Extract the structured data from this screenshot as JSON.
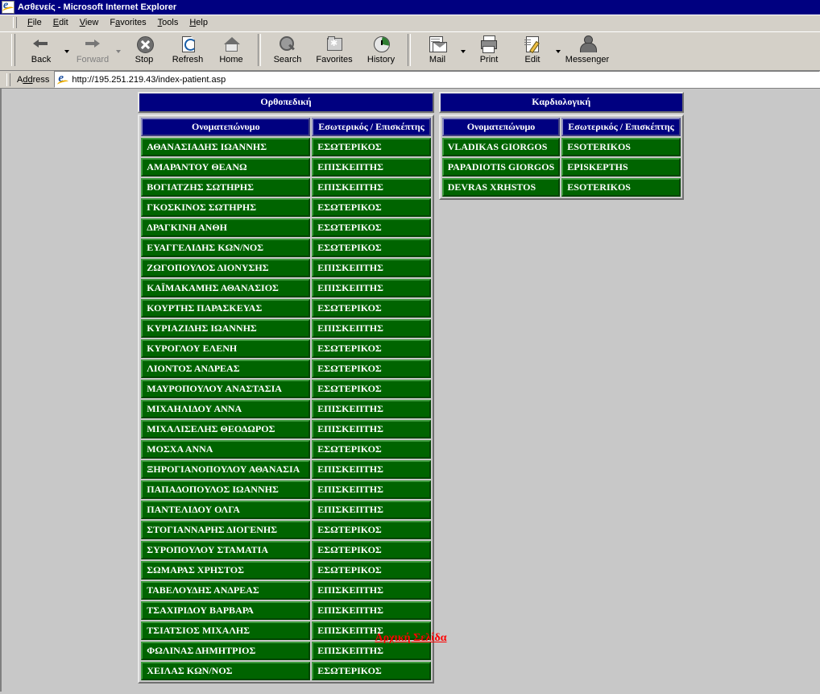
{
  "window": {
    "title": "Ασθενείς - Microsoft Internet Explorer",
    "icon": "ie-logo-icon"
  },
  "menubar": {
    "items": [
      {
        "label": "File",
        "accel": "F"
      },
      {
        "label": "Edit",
        "accel": "E"
      },
      {
        "label": "View",
        "accel": "V"
      },
      {
        "label": "Favorites",
        "accel": "a"
      },
      {
        "label": "Tools",
        "accel": "T"
      },
      {
        "label": "Help",
        "accel": "H"
      }
    ]
  },
  "toolbar": {
    "buttons": [
      {
        "label": "Back",
        "icon": "back-arrow-icon",
        "disabled": false,
        "dropdown": true
      },
      {
        "label": "Forward",
        "icon": "forward-arrow-icon",
        "disabled": true,
        "dropdown": true
      },
      {
        "label": "Stop",
        "icon": "stop-icon",
        "disabled": false,
        "dropdown": false
      },
      {
        "label": "Refresh",
        "icon": "refresh-icon",
        "disabled": false,
        "dropdown": false
      },
      {
        "label": "Home",
        "icon": "home-icon",
        "disabled": false,
        "dropdown": false
      },
      {
        "label": "Search",
        "icon": "search-icon",
        "disabled": false,
        "dropdown": false
      },
      {
        "label": "Favorites",
        "icon": "favorites-folder-icon",
        "disabled": false,
        "dropdown": false
      },
      {
        "label": "History",
        "icon": "history-clock-icon",
        "disabled": false,
        "dropdown": false
      },
      {
        "label": "Mail",
        "icon": "mail-icon",
        "disabled": false,
        "dropdown": true
      },
      {
        "label": "Print",
        "icon": "printer-icon",
        "disabled": false,
        "dropdown": false
      },
      {
        "label": "Edit",
        "icon": "edit-pencil-icon",
        "disabled": false,
        "dropdown": true
      },
      {
        "label": "Messenger",
        "icon": "messenger-person-icon",
        "disabled": false,
        "dropdown": false
      }
    ]
  },
  "address_bar": {
    "label": "Address",
    "icon": "ie-page-icon",
    "url": "http://195.251.219.43/index-patient.asp"
  },
  "page": {
    "columns": [
      "Ονοματεπώνυμο",
      "Εσωτερικός / Επισκέπτης"
    ],
    "departments": [
      {
        "name": "Ορθοπεδική",
        "rows": [
          {
            "name": "ΑΘΑΝΑΣΙΑΔΗΣ ΙΩΑΝΝΗΣ",
            "status": "ΕΣΩΤΕΡΙΚΟΣ"
          },
          {
            "name": "ΑΜΑΡΑΝΤΟΥ ΘΕΑΝΩ",
            "status": "ΕΠΙΣΚΕΠΤΗΣ"
          },
          {
            "name": "ΒΟΓΙΑΤΖΗΣ ΣΩΤΗΡΗΣ",
            "status": "ΕΠΙΣΚΕΠΤΗΣ"
          },
          {
            "name": "ΓΚΟΣΚΙΝΟΣ ΣΩΤΗΡΗΣ",
            "status": "ΕΣΩΤΕΡΙΚΟΣ"
          },
          {
            "name": "ΔΡΑΓΚΙΝΗ ΑΝΘΗ",
            "status": "ΕΣΩΤΕΡΙΚΟΣ"
          },
          {
            "name": "ΕΥΑΓΓΕΛΙΔΗΣ ΚΩΝ/ΝΟΣ",
            "status": "ΕΣΩΤΕΡΙΚΟΣ"
          },
          {
            "name": "ΖΩΓΟΠΟΥΛΟΣ ΔΙΟΝΥΣΗΣ",
            "status": "ΕΠΙΣΚΕΠΤΗΣ"
          },
          {
            "name": "ΚΑΪΜΑΚΑΜΗΣ ΑΘΑΝΑΣΙΟΣ",
            "status": "ΕΠΙΣΚΕΠΤΗΣ"
          },
          {
            "name": "ΚΟΥΡΤΗΣ ΠΑΡΑΣΚΕΥΑΣ",
            "status": "ΕΣΩΤΕΡΙΚΟΣ"
          },
          {
            "name": "ΚΥΡΙΑΖΙΔΗΣ ΙΩΑΝΝΗΣ",
            "status": "ΕΠΙΣΚΕΠΤΗΣ"
          },
          {
            "name": "ΚΥΡΟΓΛΟΥ ΕΛΕΝΗ",
            "status": "ΕΣΩΤΕΡΙΚΟΣ"
          },
          {
            "name": "ΛΙΟΝΤΟΣ ΑΝΔΡΕΑΣ",
            "status": "ΕΣΩΤΕΡΙΚΟΣ"
          },
          {
            "name": "ΜΑΥΡΟΠΟΥΛΟΥ ΑΝΑΣΤΑΣΙΑ",
            "status": "ΕΣΩΤΕΡΙΚΟΣ"
          },
          {
            "name": "ΜΙΧΑΗΛΙΔΟΥ ΑΝΝΑ",
            "status": "ΕΠΙΣΚΕΠΤΗΣ"
          },
          {
            "name": "ΜΙΧΑΛΙΣΕΛΗΣ ΘΕΟΔΩΡΟΣ",
            "status": "ΕΠΙΣΚΕΠΤΗΣ"
          },
          {
            "name": "ΜΟΣΧΑ ΑΝΝΑ",
            "status": "ΕΣΩΤΕΡΙΚΟΣ"
          },
          {
            "name": "ΞΗΡΟΓΙΑΝΟΠΟΥΛΟΥ ΑΘΑΝΑΣΙΑ",
            "status": "ΕΠΙΣΚΕΠΤΗΣ"
          },
          {
            "name": "ΠΑΠΑΔΟΠΟΥΛΟΣ ΙΩΑΝΝΗΣ",
            "status": "ΕΠΙΣΚΕΠΤΗΣ"
          },
          {
            "name": "ΠΑΝΤΕΛΙΔΟΥ ΟΛΓΑ",
            "status": "ΕΠΙΣΚΕΠΤΗΣ"
          },
          {
            "name": "ΣΤΟΓΙΑΝΝΑΡΗΣ ΔΙΟΓΕΝΗΣ",
            "status": "ΕΣΩΤΕΡΙΚΟΣ"
          },
          {
            "name": "ΣΥΡΟΠΟΥΛΟΥ ΣΤΑΜΑΤΙΑ",
            "status": "ΕΣΩΤΕΡΙΚΟΣ"
          },
          {
            "name": "ΣΩΜΑΡΑΣ ΧΡΗΣΤΟΣ",
            "status": "ΕΣΩΤΕΡΙΚΟΣ"
          },
          {
            "name": "ΤΑΒΕΛΟΥΔΗΣ ΑΝΔΡΕΑΣ",
            "status": "ΕΠΙΣΚΕΠΤΗΣ"
          },
          {
            "name": "ΤΣΑΧΙΡΙΔΟΥ ΒΑΡΒΑΡΑ",
            "status": "ΕΠΙΣΚΕΠΤΗΣ"
          },
          {
            "name": "ΤΣΙΑΤΣΙΟΣ ΜΙΧΑΛΗΣ",
            "status": "ΕΠΙΣΚΕΠΤΗΣ"
          },
          {
            "name": "ΦΩΛΙΝΑΣ ΔΗΜΗΤΡΙΟΣ",
            "status": "ΕΠΙΣΚΕΠΤΗΣ"
          },
          {
            "name": "ΧΕΙΛΑΣ ΚΩΝ/ΝΟΣ",
            "status": "ΕΣΩΤΕΡΙΚΟΣ"
          }
        ]
      },
      {
        "name": "Καρδιολογική",
        "rows": [
          {
            "name": "VLADIKAS GIORGOS",
            "status": "ESOTERIKOS"
          },
          {
            "name": "PAPADIOTIS GIORGOS",
            "status": "EPISKEPTHS"
          },
          {
            "name": "DEVRAS XRHSTOS",
            "status": "ESOTERIKOS"
          }
        ]
      }
    ],
    "footer_link": "Αρχική Σελίδα"
  },
  "colors": {
    "title_bar": "#000080",
    "header_navy": "#000080",
    "cell_green": "#006400",
    "page_background": "#c8c8c8",
    "link_red": "#ff0000",
    "chrome": "#d4d0c8"
  }
}
